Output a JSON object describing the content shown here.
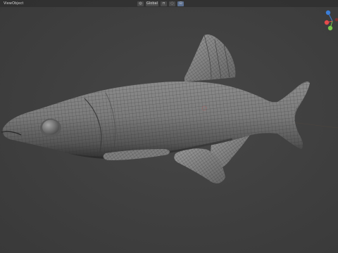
{
  "header": {
    "menus": [
      {
        "label": "View"
      },
      {
        "label": "Object"
      }
    ],
    "transform_orientation": "Global",
    "icons": [
      "pivot-point-icon",
      "snap-icon",
      "proportional-edit-icon",
      "overlay-icon"
    ]
  },
  "gizmo": {
    "axis_colors": {
      "x": "#e54b4b",
      "y": "#7ac94a",
      "z": "#3b7ed9"
    }
  },
  "viewport": {
    "background": "#3f3f3f",
    "mesh": "fish"
  }
}
